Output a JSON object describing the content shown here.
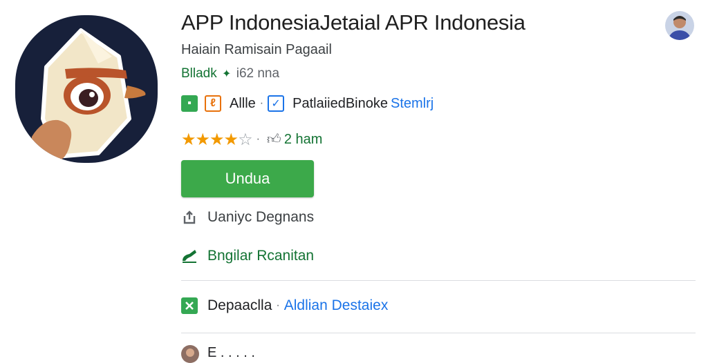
{
  "app": {
    "title": "APP IndonesiaJetaial APR Indonesia",
    "developer": "Haiain Ramisain Pagaail",
    "rating_label": "Blladk",
    "rating_count": "i62 nna"
  },
  "badges": {
    "category_label": "Allle",
    "content_label": "Patlaiied",
    "content_sublabel": "Binoke",
    "link_label": "Stemlrj"
  },
  "reviews": {
    "stars_filled": 4,
    "stars_total": 5,
    "time_label": "2 ham"
  },
  "install_button": {
    "label": "Undua"
  },
  "rows": {
    "share_label": "Uaniyc Degnans",
    "review_label": "Bngilar Rcanitan",
    "developer_meta_label": "Depaaclla",
    "developer_meta_link": "Aldlian Destaiex"
  },
  "footer": {
    "partial_text": "E . . . . ."
  },
  "colors": {
    "accent_green": "#3ca94a",
    "text_green": "#137333",
    "link_blue": "#1a73e8",
    "star_orange": "#f29900"
  },
  "icons": {
    "app_icon": "cartoon-bird-app-icon",
    "share_icon": "share-icon",
    "review_icon": "pencil-icon",
    "dev_icon": "close-square-icon"
  }
}
